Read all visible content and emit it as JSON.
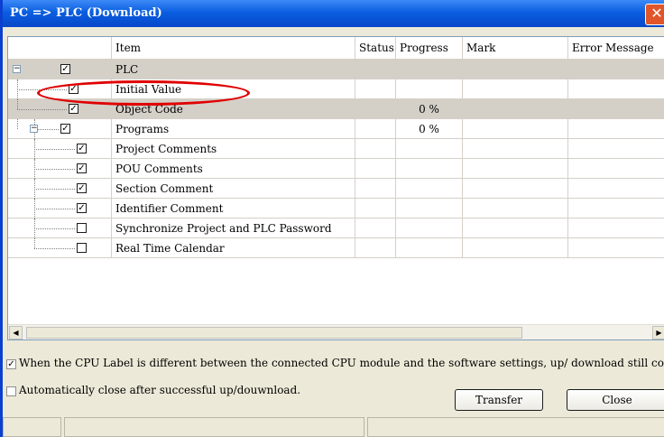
{
  "window": {
    "title": "PC => PLC (Download)",
    "close_icon": "close-icon"
  },
  "grid": {
    "headers": [
      "Item",
      "Status",
      "Progress",
      "Mark",
      "Error Message"
    ],
    "rows": [
      {
        "item": "PLC",
        "progress": "",
        "checked": true,
        "toggle": "minus"
      },
      {
        "item": "Initial Value",
        "progress": "",
        "checked": true
      },
      {
        "item": "Object Code",
        "progress": "0 %",
        "checked": true
      },
      {
        "item": "Programs",
        "progress": "0 %",
        "checked": true,
        "toggle": "minus"
      },
      {
        "item": "Project Comments",
        "progress": "",
        "checked": true
      },
      {
        "item": "POU Comments",
        "progress": "",
        "checked": true
      },
      {
        "item": "Section Comment",
        "progress": "",
        "checked": true
      },
      {
        "item": "Identifier Comment",
        "progress": "",
        "checked": true
      },
      {
        "item": "Synchronize Project and PLC Password",
        "progress": "",
        "checked": false
      },
      {
        "item": "Real Time Calendar",
        "progress": "",
        "checked": false
      }
    ],
    "scroll_left_icon": "scroll-left-arrow-icon",
    "scroll_right_icon": "scroll-right-arrow-icon"
  },
  "options": {
    "cpu_label_text": "When the CPU Label is different between the connected CPU module and the software settings, up/ download still cont",
    "cpu_label_checked": true,
    "auto_close_text": "Automatically close after successful up/douwnload.",
    "auto_close_checked": false
  },
  "buttons": {
    "transfer": "Transfer",
    "close": "Close"
  },
  "colors": {
    "titlebar": "#0a5ee0",
    "highlight_oval": "#e00000",
    "row_gray": "#d4d0c8"
  }
}
